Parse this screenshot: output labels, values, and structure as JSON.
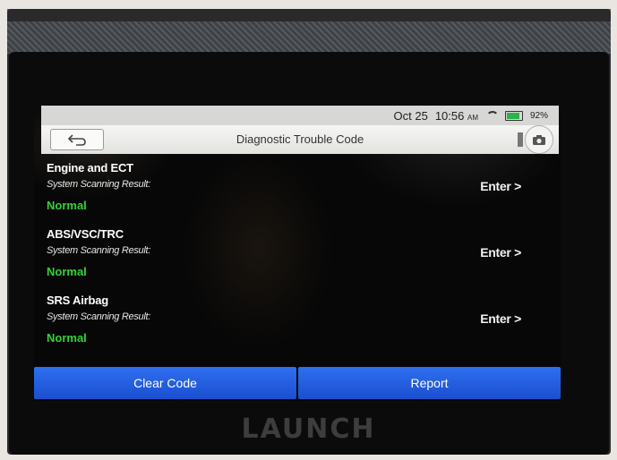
{
  "statusbar": {
    "date": "Oct 25",
    "time": "10:56",
    "ampm": "AM",
    "battery": "92%"
  },
  "header": {
    "title": "Diagnostic Trouble Code",
    "back_icon": "back-arrow-icon",
    "camera_icon": "camera-icon"
  },
  "systems": [
    {
      "name": "Engine and ECT",
      "label": "System Scanning Result:",
      "status": "Normal",
      "action": "Enter >"
    },
    {
      "name": "ABS/VSC/TRC",
      "label": "System Scanning Result:",
      "status": "Normal",
      "action": "Enter >"
    },
    {
      "name": "SRS Airbag",
      "label": "System Scanning Result:",
      "status": "Normal",
      "action": "Enter >"
    }
  ],
  "actions": {
    "clear_code": "Clear Code",
    "report": "Report"
  },
  "device": {
    "brand": "LAUNCH"
  },
  "colors": {
    "status_normal": "#35d13a",
    "action_button": "#1f5ae0"
  }
}
